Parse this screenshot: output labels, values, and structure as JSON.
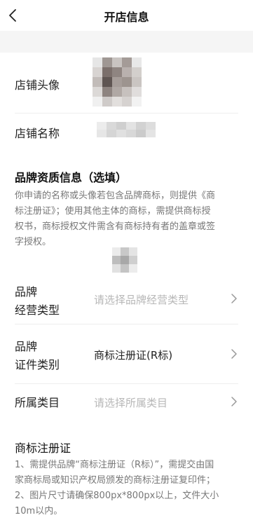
{
  "header": {
    "title": "开店信息"
  },
  "store": {
    "avatar_label": "店铺头像",
    "name_label": "店铺名称"
  },
  "brand": {
    "section_title": "品牌资质信息（选填）",
    "description_lines": [
      "你申请的名称或头像若包含品牌商标，则提供《商",
      "标注册证》；使用其他主体的商标，需提供商标授",
      "权书，商标授权文件需含有商标持有者的盖章或签",
      "字授权。"
    ],
    "business_type": {
      "label_line1": "品牌",
      "label_line2": "经营类型",
      "placeholder": "请选择品牌经营类型"
    },
    "certificate_type": {
      "label_line1": "品牌",
      "label_line2": "证件类别",
      "value": "商标注册证(R标)"
    },
    "category": {
      "label": "所属类目",
      "placeholder": "请选择所属类目"
    }
  },
  "trademark": {
    "title": "商标注册证",
    "notes_lines": [
      "1、需提供品牌“商标注册证（R标）”，需提交由国",
      "家商标局或知识产权局颁发的商标注册证复印件；",
      "2、图片尺寸请确保800px*800px以上，文件大小",
      "10m以内。"
    ]
  },
  "colors": {
    "divider": "#eeeeee",
    "placeholder": "#b7b7b7",
    "secondary_text": "#777777",
    "page_bg": "#f5f5f5"
  },
  "icons": {
    "back": "chevron-left-icon",
    "row_arrow": "chevron-right-icon"
  }
}
